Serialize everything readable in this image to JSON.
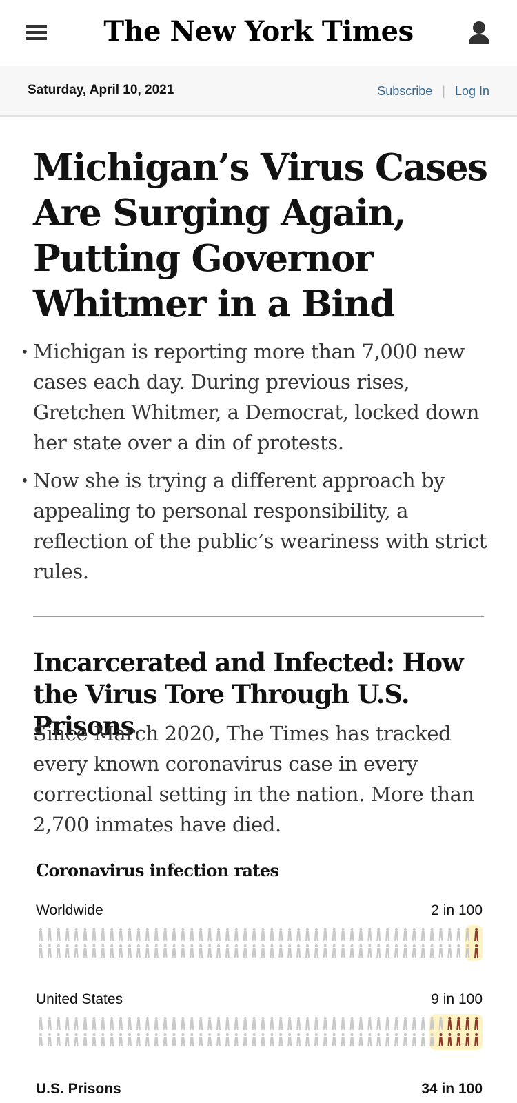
{
  "header": {
    "logo_text": "The New York Times",
    "menu_icon": "hamburger-menu-icon",
    "account_icon": "user-account-icon"
  },
  "datebar": {
    "date": "Saturday, April 10, 2021",
    "subscribe_label": "Subscribe",
    "separator": "|",
    "login_label": "Log In"
  },
  "story1": {
    "headline": "Michigan’s Virus Cases Are Surging Again, Putting Governor Whitmer in a Bind",
    "bullet": "•",
    "summary": [
      "Michigan is reporting more than 7,000 new cases each day. During previous rises, Gretchen Whitmer, a Democrat, locked down her state over a din of protests.",
      "Now she is trying a different approach by appealing to personal responsibility, a reflection of the public’s weariness with strict rules."
    ]
  },
  "story2": {
    "headline": "Incarcerated and Infected: How the Virus Tore Through U.S. Prisons",
    "summary": "Since March 2020, The Times has tracked every known coronavirus case in every correctional setting in the nation. More than 2,700 inmates have died."
  },
  "graphic": {
    "title": "Coronavirus infection rates",
    "rows": [
      {
        "label": "Worldwide",
        "rate": "2 in 100",
        "infected": 2
      },
      {
        "label": "United States",
        "rate": "9 in 100",
        "infected": 9
      },
      {
        "label": "U.S. Prisons",
        "rate": "34 in 100",
        "infected": 34
      }
    ],
    "colors": {
      "healthy": "#c9c9c9",
      "infected": "#8a3b2c",
      "glow": "#fff3c4"
    }
  }
}
